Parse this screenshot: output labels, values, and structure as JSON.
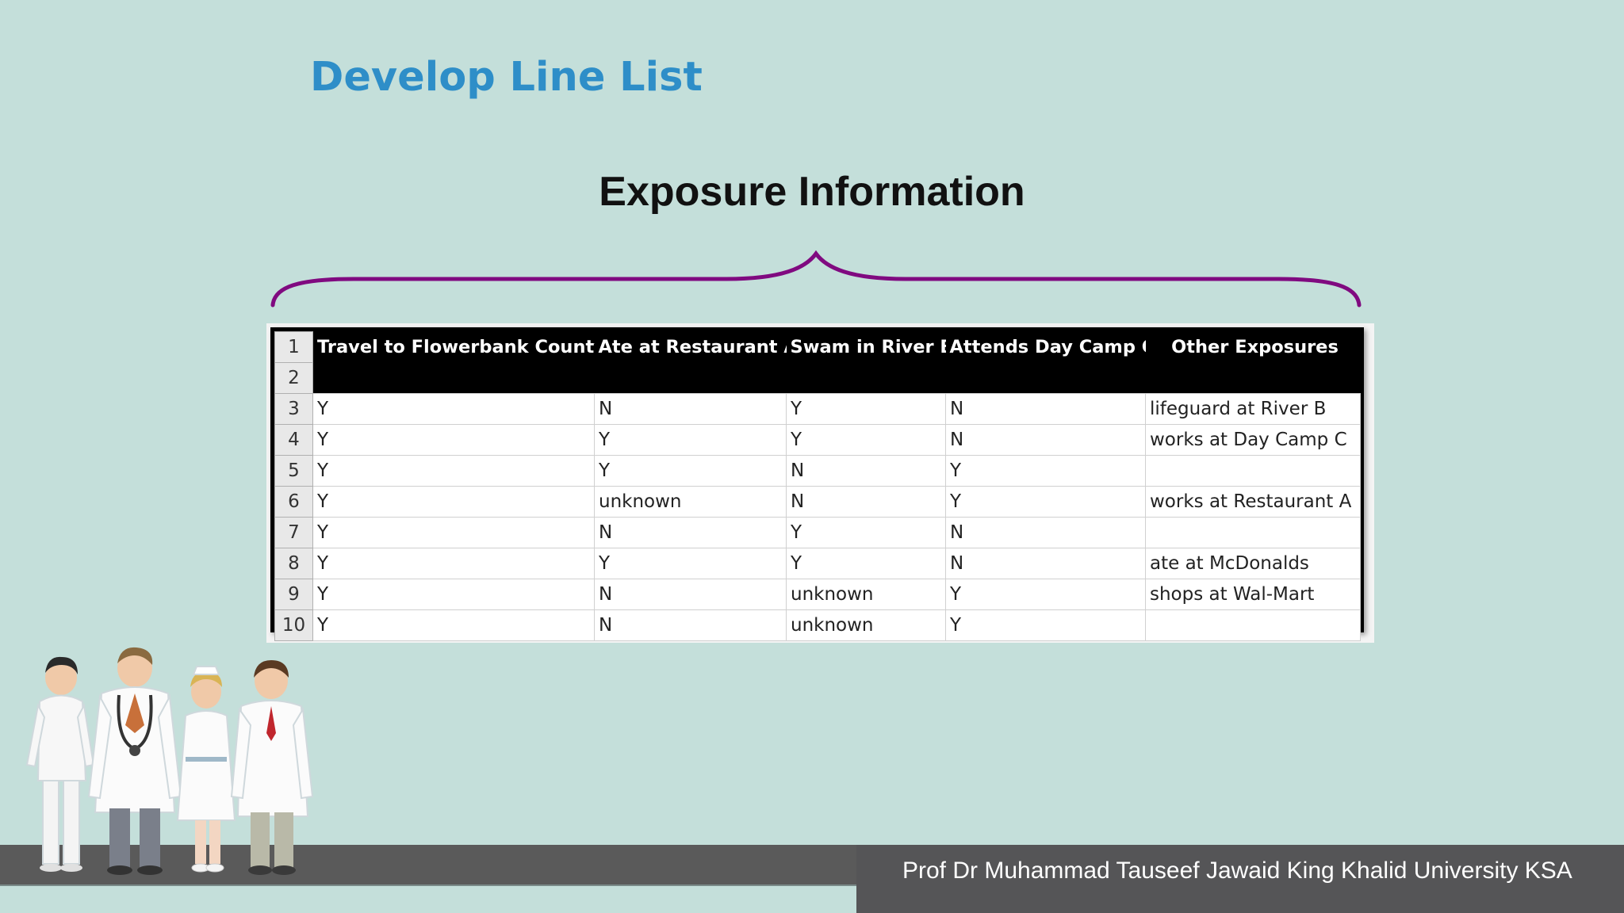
{
  "slide": {
    "title": "Develop Line List",
    "subtitle": "Exposure Information",
    "footer": "Prof Dr Muhammad Tauseef Jawaid King Khalid University KSA"
  },
  "colors": {
    "background": "#c4dfda",
    "title": "#2e8ec8",
    "brace": "#800a80",
    "footer": "#555557"
  },
  "table": {
    "headers": [
      "Travel to Flowerbank County",
      "Ate at Restaurant A",
      "Swam in River B",
      "Attends Day Camp C",
      "Other Exposures"
    ],
    "row_numbers": [
      "1",
      "2",
      "3",
      "4",
      "5",
      "6",
      "7",
      "8",
      "9",
      "10"
    ],
    "rows": [
      [
        "Y",
        "N",
        "Y",
        "N",
        "lifeguard at River B"
      ],
      [
        "Y",
        "Y",
        "Y",
        "N",
        "works at Day Camp C"
      ],
      [
        "Y",
        "Y",
        "N",
        "Y",
        ""
      ],
      [
        "Y",
        "unknown",
        "N",
        "Y",
        "works at Restaurant A"
      ],
      [
        "Y",
        "N",
        "Y",
        "N",
        ""
      ],
      [
        "Y",
        "Y",
        "Y",
        "N",
        "ate at McDonalds"
      ],
      [
        "Y",
        "N",
        "unknown",
        "Y",
        "shops at Wal-Mart"
      ],
      [
        "Y",
        "N",
        "unknown",
        "Y",
        ""
      ]
    ]
  },
  "illustration": "medical-staff-group"
}
